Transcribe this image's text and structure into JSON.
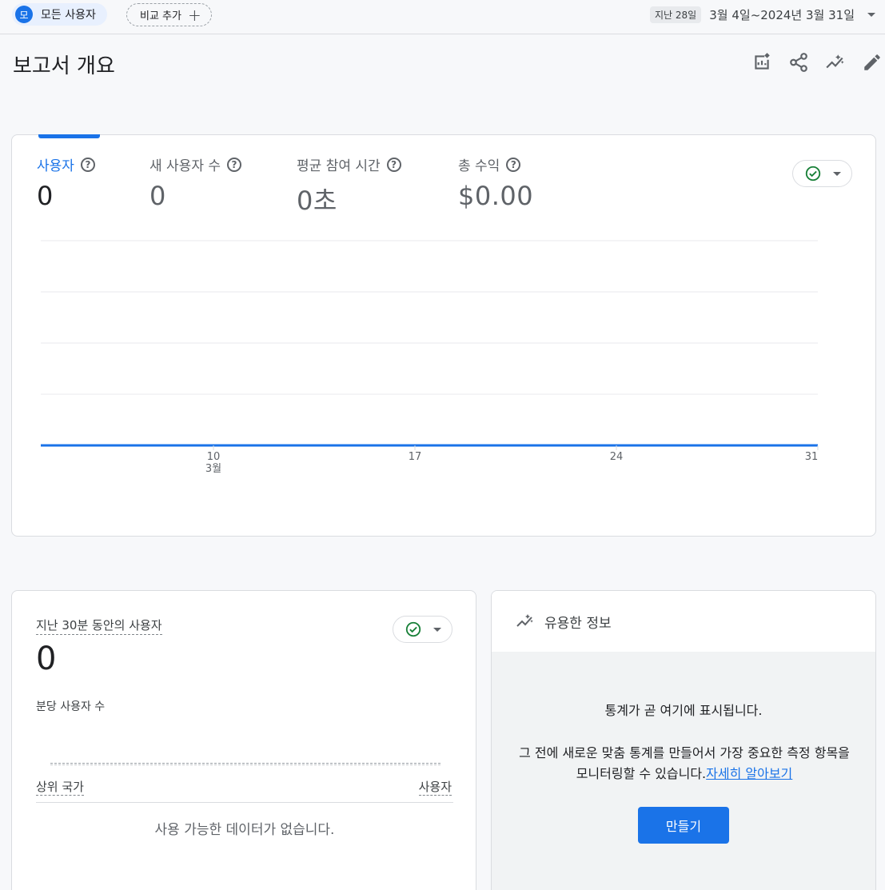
{
  "topbar": {
    "segment_avatar": "모",
    "segment_label": "모든 사용자",
    "compare_label": "비교 추가",
    "date_preset": "지난 28일",
    "date_range": "3월 4일~2024년 3월 31일"
  },
  "page": {
    "title": "보고서 개요"
  },
  "metrics": [
    {
      "label": "사용자",
      "value": "0"
    },
    {
      "label": "새 사용자 수",
      "value": "0"
    },
    {
      "label": "평균 참여 시간",
      "value": "0초"
    },
    {
      "label": "총 수익",
      "value": "$0.00"
    }
  ],
  "chart_data": {
    "type": "line",
    "x_ticks": [
      "10",
      "17",
      "24",
      "31"
    ],
    "x_month_label": "3월",
    "series": [
      {
        "values": [
          0,
          0,
          0,
          0,
          0,
          0,
          0,
          0,
          0,
          0,
          0,
          0,
          0,
          0,
          0,
          0,
          0,
          0,
          0,
          0,
          0,
          0,
          0,
          0,
          0,
          0,
          0,
          0
        ]
      }
    ],
    "grid": true,
    "color": "#1a73e8"
  },
  "realtime": {
    "title": "지난 30분 동안의 사용자",
    "value": "0",
    "subtitle": "분당 사용자 수",
    "col_country": "상위 국가",
    "col_users": "사용자",
    "empty": "사용 가능한 데이터가 없습니다."
  },
  "insights": {
    "title": "유용한 정보",
    "line1": "통계가 곧 여기에 표시됩니다.",
    "line2": "그 전에 새로운 맞춤 통계를 만들어서 가장 중요한 측정 항목을 모니터링할 수 있습니다.",
    "link": "자세히 알아보기",
    "button": "만들기"
  },
  "colors": {
    "accent": "#1a73e8",
    "check": "#188038"
  }
}
